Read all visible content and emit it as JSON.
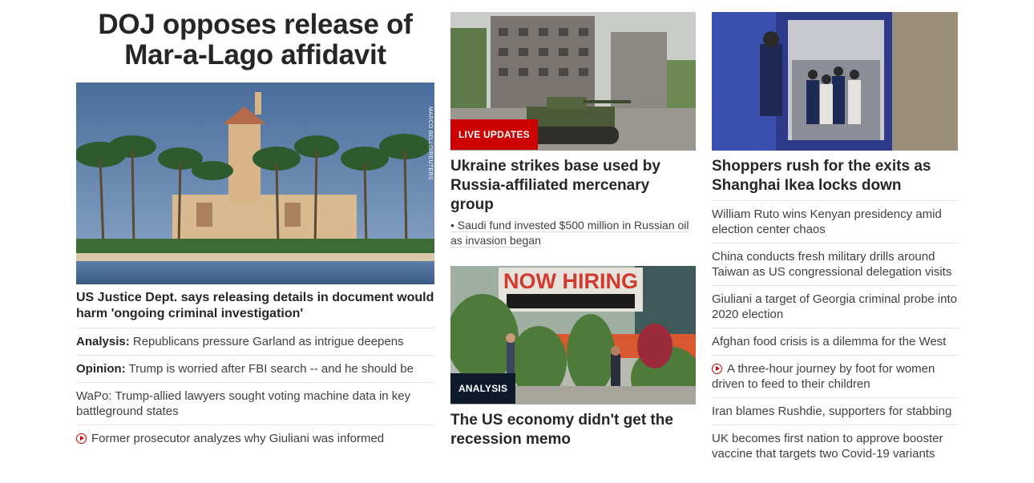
{
  "col1": {
    "headline_line1": "DOJ opposes release of",
    "headline_line2": "Mar-a-Lago affidavit",
    "photo_credit": "MARCO BELLO/REUTERS",
    "card_title": "US Justice Dept. says releasing details in document would harm 'ongoing criminal investigation'",
    "links": [
      {
        "prefix": "Analysis:",
        "text": "Republicans pressure Garland as intrigue deepens"
      },
      {
        "prefix": "Opinion:",
        "text": "Trump is worried after FBI search -- and he should be"
      },
      {
        "prefix": "",
        "text": "WaPo: Trump-allied lawyers sought voting machine data in key battleground states"
      },
      {
        "prefix": "",
        "text": "Former prosecutor analyzes why Giuliani was informed",
        "icon": "play-icon"
      }
    ]
  },
  "col2": {
    "story1": {
      "badge": "LIVE UPDATES",
      "title": "Ukraine strikes base used by Russia-affiliated mercenary group",
      "bullet": "• Saudi fund invested $500 million in Russian oil as invasion began"
    },
    "story2": {
      "badge": "ANALYSIS",
      "sign_text": "NOW HIRING",
      "title": "The US economy didn't get the recession memo"
    }
  },
  "col3": {
    "card_title": "Shoppers rush for the exits as Shanghai Ikea locks down",
    "links": [
      {
        "text": "William Ruto wins Kenyan presidency amid election center chaos"
      },
      {
        "text": "China conducts fresh military drills around Taiwan as US congressional delegation visits"
      },
      {
        "text": "Giuliani a target of Georgia criminal probe into 2020 election"
      },
      {
        "text": "Afghan food crisis is a dilemma for the West"
      },
      {
        "text": "A three-hour journey by foot for women driven to feed to their children",
        "icon": "play-icon"
      },
      {
        "text": "Iran blames Rushdie, supporters for stabbing"
      },
      {
        "text": "UK becomes first nation to approve booster vaccine that targets two Covid-19 variants"
      }
    ]
  },
  "colors": {
    "live_badge": "#cc0000",
    "analysis_badge": "#0c1a2b",
    "text": "#262626",
    "play_icon": "#cc0000"
  }
}
